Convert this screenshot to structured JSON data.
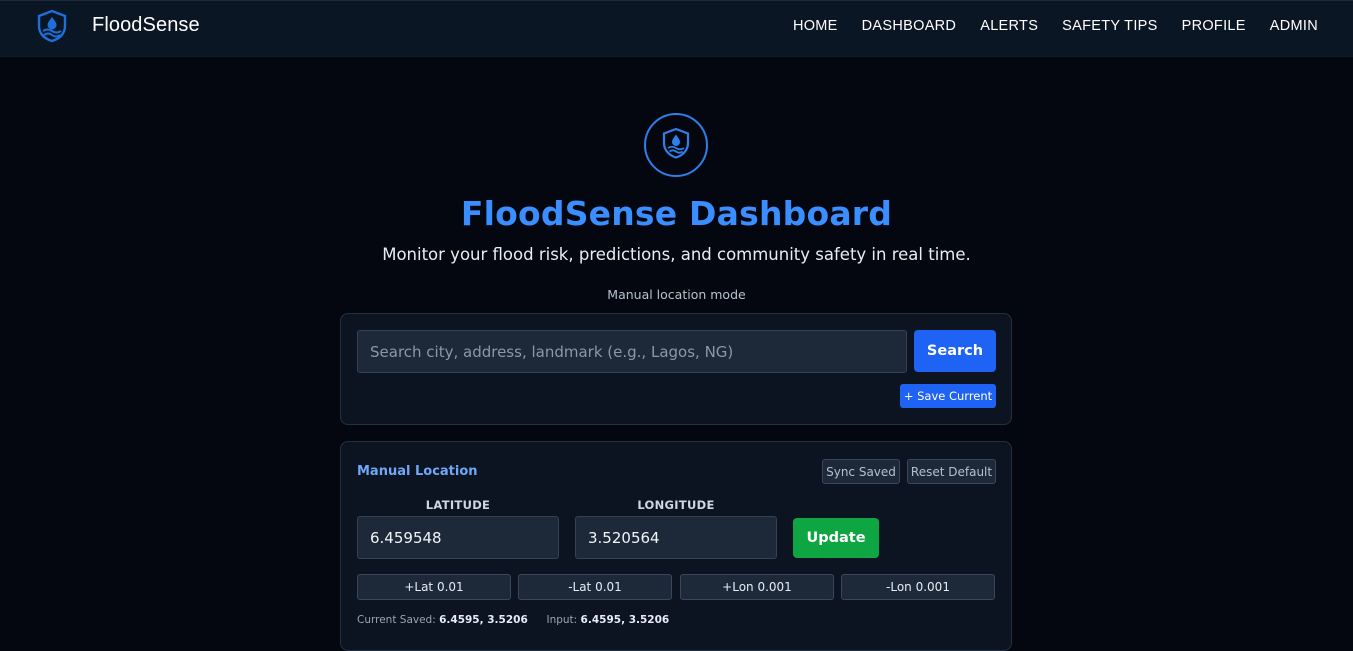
{
  "navbar": {
    "brand": "FloodSense",
    "links": [
      "HOME",
      "DASHBOARD",
      "ALERTS",
      "SAFETY TIPS",
      "PROFILE",
      "ADMIN"
    ]
  },
  "hero": {
    "title": "FloodSense Dashboard",
    "subtitle": "Monitor your flood risk, predictions, and community safety in real time.",
    "mode": "Manual location mode"
  },
  "search": {
    "placeholder": "Search city, address, landmark (e.g., Lagos, NG)",
    "value": "",
    "search_label": "Search",
    "save_label": "+ Save Current"
  },
  "manual_location": {
    "heading": "Manual Location",
    "sync_label": "Sync Saved",
    "reset_label": "Reset Default",
    "latitude_label": "LATITUDE",
    "longitude_label": "LONGITUDE",
    "latitude_value": "6.459548",
    "longitude_value": "3.520564",
    "update_label": "Update",
    "steps": [
      "+Lat 0.01",
      "-Lat 0.01",
      "+Lon 0.001",
      "-Lon 0.001"
    ],
    "current_saved_label": "Current Saved:",
    "current_saved_value": "6.4595, 3.5206",
    "input_label": "Input:",
    "input_value": "6.4595, 3.5206"
  },
  "colors": {
    "accent": "#3b8eff",
    "primary_button": "#1f63f5",
    "update_button": "#0ea543",
    "background": "#04070f",
    "navbar": "#0b1625"
  },
  "icons": {
    "brand": "shield-water-icon",
    "hero": "water-drop-shield-icon"
  }
}
